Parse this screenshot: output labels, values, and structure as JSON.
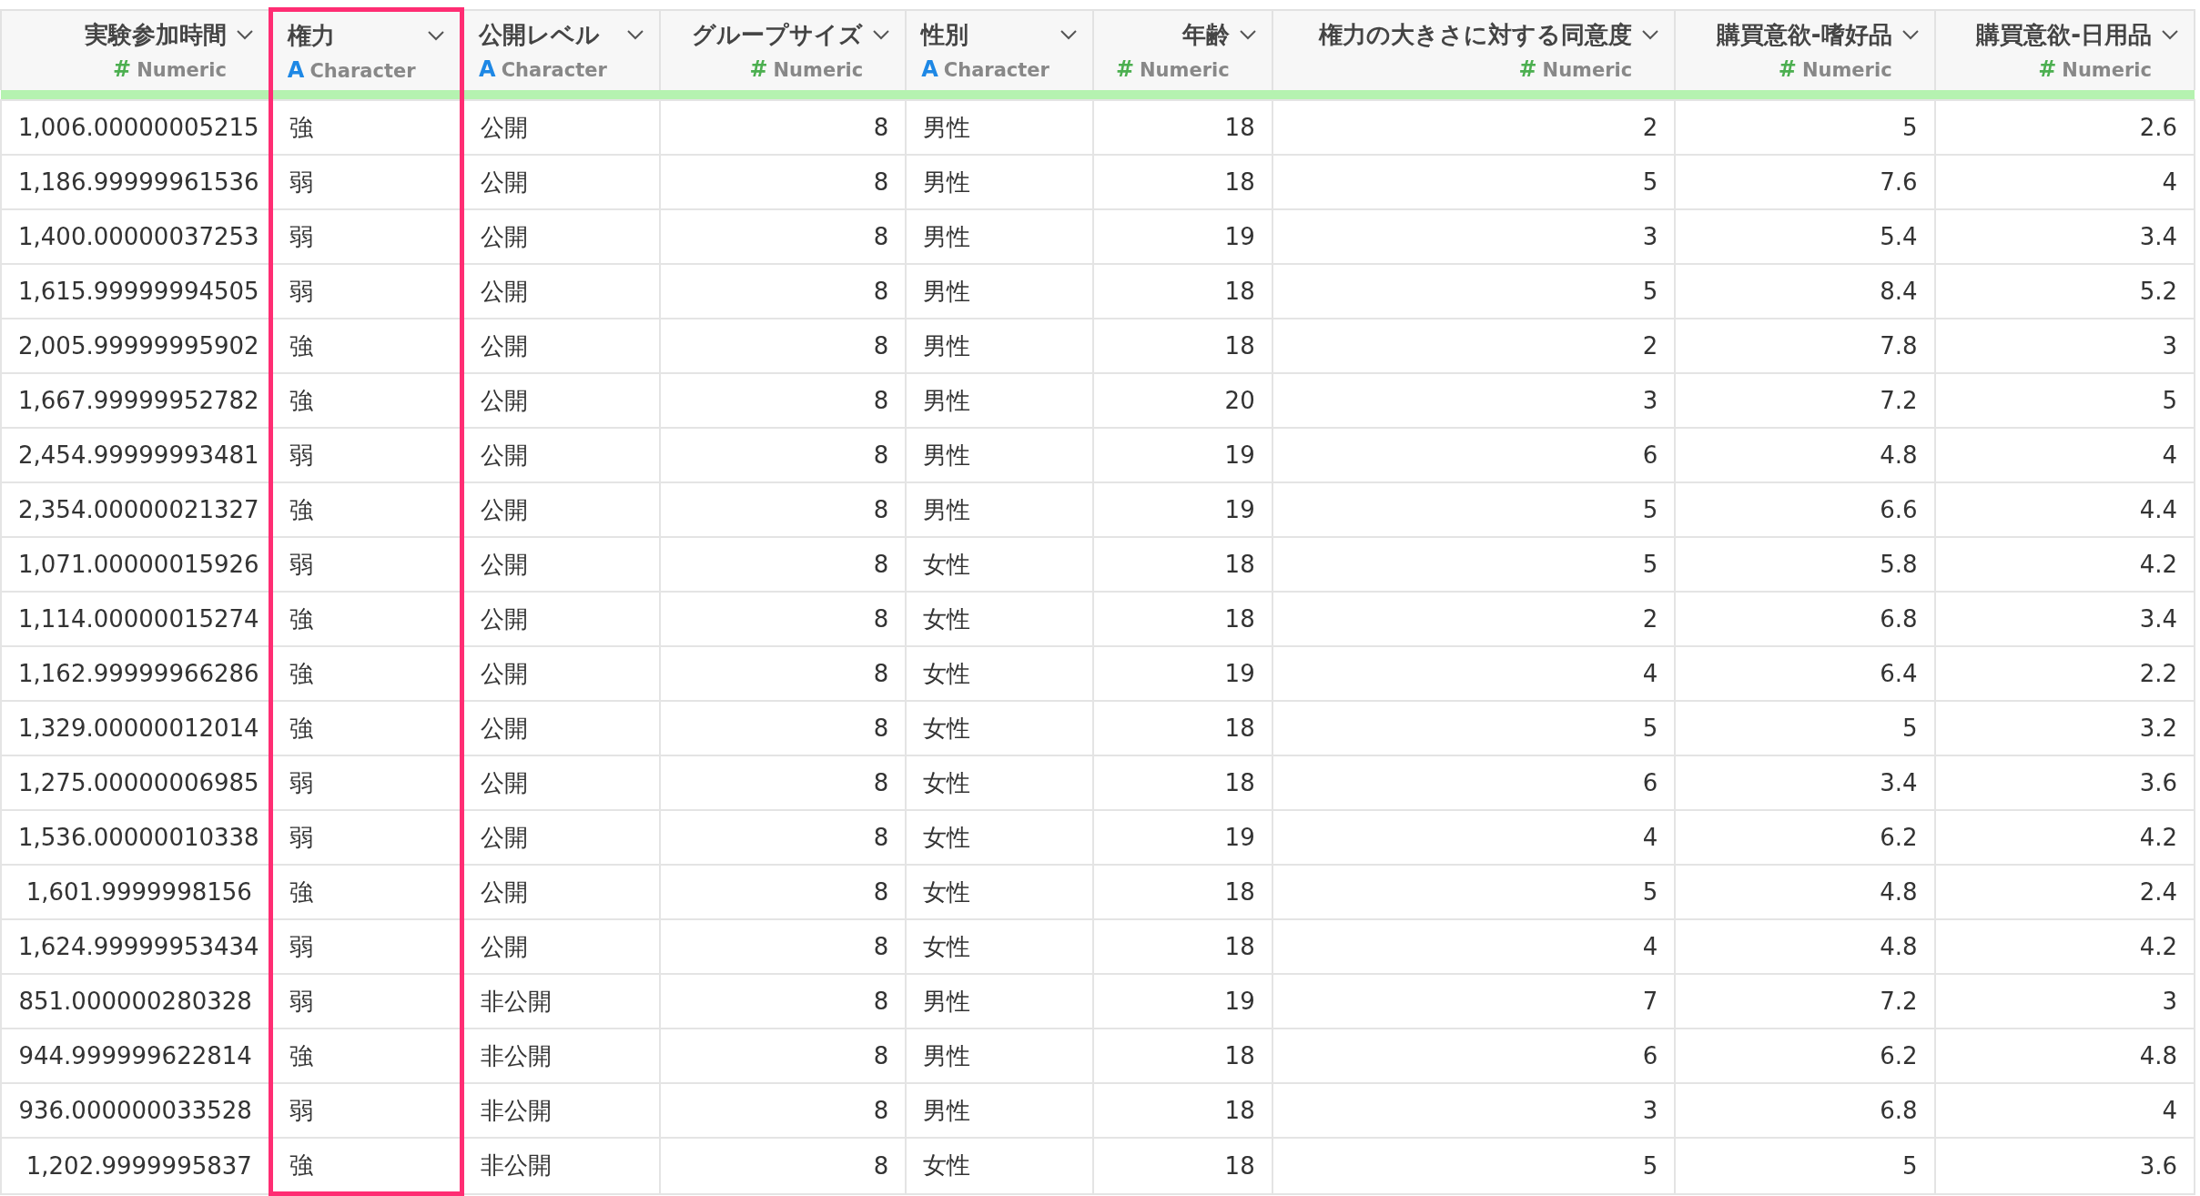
{
  "table": {
    "columns": [
      {
        "title": "実験参加時間",
        "kind": "numeric",
        "type_icon": "#",
        "type_label": "Numeric",
        "highlighted": false
      },
      {
        "title": "権力",
        "kind": "character",
        "type_icon": "A",
        "type_label": "Character",
        "highlighted": true
      },
      {
        "title": "公開レベル",
        "kind": "character",
        "type_icon": "A",
        "type_label": "Character",
        "highlighted": false
      },
      {
        "title": "グループサイズ",
        "kind": "numeric",
        "type_icon": "#",
        "type_label": "Numeric",
        "highlighted": false
      },
      {
        "title": "性別",
        "kind": "character",
        "type_icon": "A",
        "type_label": "Character",
        "highlighted": false
      },
      {
        "title": "年齢",
        "kind": "numeric",
        "type_icon": "#",
        "type_label": "Numeric",
        "highlighted": false
      },
      {
        "title": "権力の大きさに対する同意度",
        "kind": "numeric",
        "type_icon": "#",
        "type_label": "Numeric",
        "highlighted": false
      },
      {
        "title": "購買意欲-嗜好品",
        "kind": "numeric",
        "type_icon": "#",
        "type_label": "Numeric",
        "highlighted": false
      },
      {
        "title": "購買意欲-日用品",
        "kind": "numeric",
        "type_icon": "#",
        "type_label": "Numeric",
        "highlighted": false
      }
    ],
    "rows": [
      [
        "1,006.00000005215",
        "強",
        "公開",
        "8",
        "男性",
        "18",
        "2",
        "5",
        "2.6"
      ],
      [
        "1,186.99999961536",
        "弱",
        "公開",
        "8",
        "男性",
        "18",
        "5",
        "7.6",
        "4"
      ],
      [
        "1,400.00000037253",
        "弱",
        "公開",
        "8",
        "男性",
        "19",
        "3",
        "5.4",
        "3.4"
      ],
      [
        "1,615.99999994505",
        "弱",
        "公開",
        "8",
        "男性",
        "18",
        "5",
        "8.4",
        "5.2"
      ],
      [
        "2,005.99999995902",
        "強",
        "公開",
        "8",
        "男性",
        "18",
        "2",
        "7.8",
        "3"
      ],
      [
        "1,667.99999952782",
        "強",
        "公開",
        "8",
        "男性",
        "20",
        "3",
        "7.2",
        "5"
      ],
      [
        "2,454.99999993481",
        "弱",
        "公開",
        "8",
        "男性",
        "19",
        "6",
        "4.8",
        "4"
      ],
      [
        "2,354.00000021327",
        "強",
        "公開",
        "8",
        "男性",
        "19",
        "5",
        "6.6",
        "4.4"
      ],
      [
        "1,071.00000015926",
        "弱",
        "公開",
        "8",
        "女性",
        "18",
        "5",
        "5.8",
        "4.2"
      ],
      [
        "1,114.00000015274",
        "強",
        "公開",
        "8",
        "女性",
        "18",
        "2",
        "6.8",
        "3.4"
      ],
      [
        "1,162.99999966286",
        "強",
        "公開",
        "8",
        "女性",
        "19",
        "4",
        "6.4",
        "2.2"
      ],
      [
        "1,329.00000012014",
        "強",
        "公開",
        "8",
        "女性",
        "18",
        "5",
        "5",
        "3.2"
      ],
      [
        "1,275.00000006985",
        "弱",
        "公開",
        "8",
        "女性",
        "18",
        "6",
        "3.4",
        "3.6"
      ],
      [
        "1,536.00000010338",
        "弱",
        "公開",
        "8",
        "女性",
        "19",
        "4",
        "6.2",
        "4.2"
      ],
      [
        "1,601.9999998156",
        "強",
        "公開",
        "8",
        "女性",
        "18",
        "5",
        "4.8",
        "2.4"
      ],
      [
        "1,624.99999953434",
        "弱",
        "公開",
        "8",
        "女性",
        "18",
        "4",
        "4.8",
        "4.2"
      ],
      [
        "851.000000280328",
        "弱",
        "非公開",
        "8",
        "男性",
        "19",
        "7",
        "7.2",
        "3"
      ],
      [
        "944.999999622814",
        "強",
        "非公開",
        "8",
        "男性",
        "18",
        "6",
        "6.2",
        "4.8"
      ],
      [
        "936.000000033528",
        "弱",
        "非公開",
        "8",
        "男性",
        "18",
        "3",
        "6.8",
        "4"
      ],
      [
        "1,202.9999995837",
        "強",
        "非公開",
        "8",
        "女性",
        "18",
        "5",
        "5",
        "3.6"
      ]
    ]
  }
}
